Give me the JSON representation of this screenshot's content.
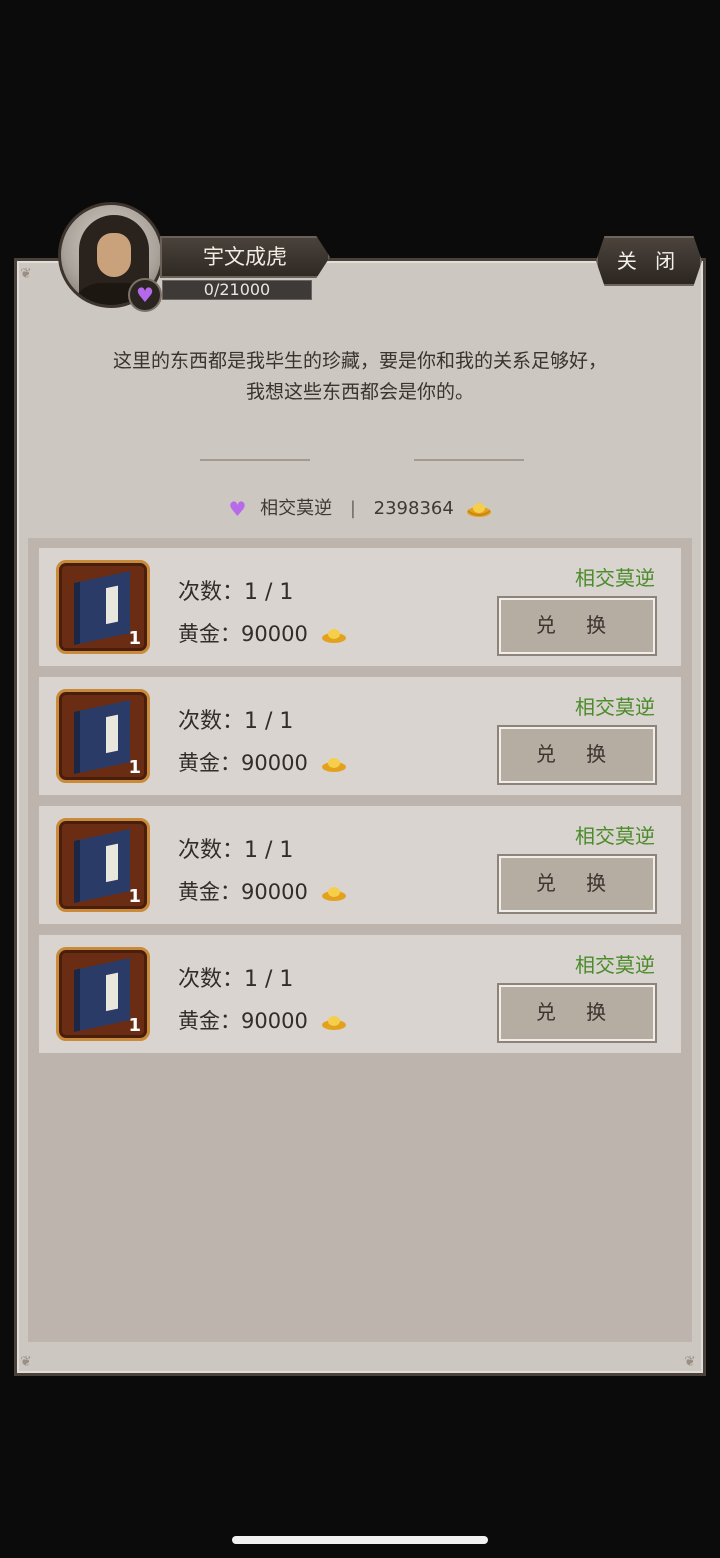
{
  "npc": {
    "name": "宇文成虎",
    "progress_text": "0/21000",
    "badge_icon": "heart-icon",
    "badge_color": "#b469ea"
  },
  "close_label": "关 闭",
  "description": [
    "这里的东西都是我毕生的珍藏，要是你和我的关系足够好，",
    "我想这些东西都会是你的。"
  ],
  "relation": {
    "level": "相交莫逆",
    "gold": "2398364"
  },
  "items": [
    {
      "count_label": "次数：1 / 1",
      "price_label": "黄金：",
      "price": "90000",
      "requirement": "相交莫逆",
      "button": "兑 换",
      "qty": "1"
    },
    {
      "count_label": "次数：1 / 1",
      "price_label": "黄金：",
      "price": "90000",
      "requirement": "相交莫逆",
      "button": "兑 换",
      "qty": "1"
    },
    {
      "count_label": "次数：1 / 1",
      "price_label": "黄金：",
      "price": "90000",
      "requirement": "相交莫逆",
      "button": "兑 换",
      "qty": "1"
    },
    {
      "count_label": "次数：1 / 1",
      "price_label": "黄金：",
      "price": "90000",
      "requirement": "相交莫逆",
      "button": "兑 换",
      "qty": "1"
    }
  ],
  "colors": {
    "requirement_green": "#4b8b2a",
    "panel_bg": "#cdc7c1"
  }
}
